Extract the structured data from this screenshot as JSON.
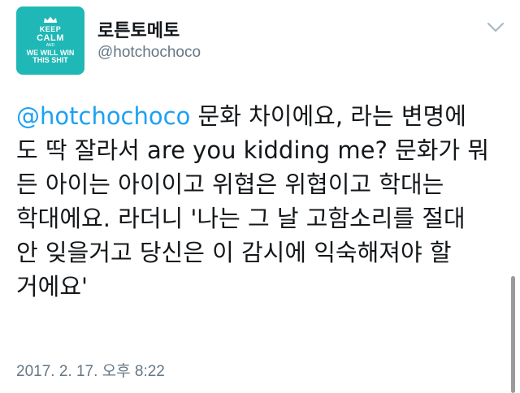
{
  "tweet": {
    "avatar": {
      "lines": [
        "KEEP",
        "CALM",
        "AND",
        "WE WILL WIN",
        "THIS SHIT"
      ],
      "color": "#1fb8b6"
    },
    "display_name": "로튼토메토",
    "handle": "@hotchochoco",
    "menu_icon": "chevron-down-icon",
    "text": {
      "mention": "@hotchochoco",
      "line1_rest": " 문화 차이에요, 라는 변명에",
      "line2": "도 딱 잘라서 are you kidding me? 문화가 뭐",
      "line3": "든 아이는 아이이고 위협은 위협이고 학대는",
      "line4": "학대에요. 라더니 '나는 그 날 고함소리를 절대",
      "line5": "안 잊을거고 당신은 이 감시에 익숙해져야 할",
      "line6": "거에요'"
    },
    "timestamp": "2017. 2. 17. 오후 8:22"
  },
  "colors": {
    "link": "#1da1f2",
    "secondary_text": "#657786",
    "primary_text": "#14171a"
  }
}
